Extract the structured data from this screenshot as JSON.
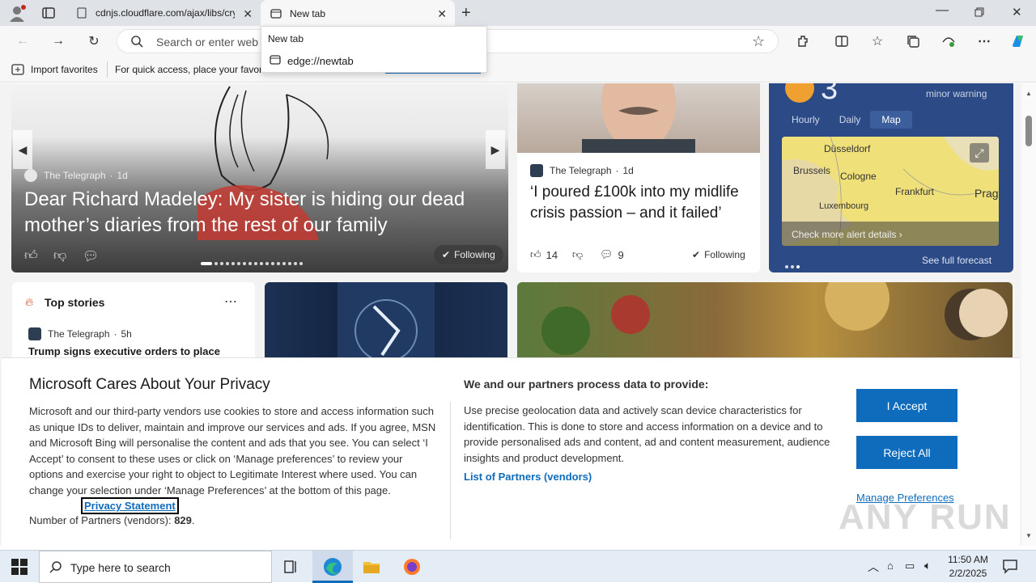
{
  "browser": {
    "tabs": [
      {
        "label": "cdnjs.cloudflare.com/ajax/libs/crypt",
        "active": false
      },
      {
        "label": "New tab",
        "active": true
      }
    ],
    "address_placeholder": "Search or enter web address",
    "dropdown": {
      "title": "New tab",
      "url": "edge://newtab"
    },
    "favorites": {
      "import_label": "Import favorites",
      "hint": "For quick access, place your favorites here on the favorites bar.",
      "manage_link": "Manage favorites now"
    }
  },
  "feed": {
    "hero": {
      "source": "The Telegraph",
      "age": "1d",
      "headline": "Dear Richard Madeley: My sister is hiding our dead mother’s diaries from the rest of our family",
      "following": "Following"
    },
    "story2": {
      "source": "The Telegraph",
      "age": "1d",
      "headline": "‘I poured £100k into my midlife crisis passion – and it failed’",
      "likes": "14",
      "comments": "9",
      "following": "Following"
    },
    "weather": {
      "temp": "3",
      "alert": "minor warning",
      "tabs": [
        "Hourly",
        "Daily",
        "Map"
      ],
      "active_tab": "Map",
      "cities": [
        "Düsseldorf",
        "Brussels",
        "Cologne",
        "Frankfurt",
        "Prag",
        "Luxembourg"
      ],
      "alert_link": "Check more alert details",
      "forecast_link": "See full forecast"
    },
    "top_stories": {
      "title": "Top stories",
      "source": "The Telegraph",
      "age": "5h",
      "headline": "Trump signs executive orders to place"
    }
  },
  "privacy": {
    "title": "Microsoft Cares About Your Privacy",
    "body": "Microsoft and our third-party vendors use cookies to store and access information such as unique IDs to deliver, maintain and improve our services and ads. If you agree, MSN and Microsoft Bing will personalise the content and ads that you see. You can select ‘I Accept’ to consent to these uses or click on ‘Manage preferences’ to review your options and exercise your right to object to Legitimate Interest where used.  You can change your selection under ‘Manage Preferences’ at the bottom of this page.",
    "privacy_link": "Privacy Statement",
    "partners_prefix": "Number of Partners (vendors):",
    "partners_count": "829",
    "right_title": "We and our partners process data to provide:",
    "right_body": "Use precise geolocation data and actively scan device characteristics for identification. This is done to store and access information on a device and to provide personalised ads and content, ad and content measurement, audience insights and product development.",
    "partners_link": "List of Partners (vendors)",
    "accept": "I Accept",
    "reject": "Reject All",
    "manage": "Manage Preferences"
  },
  "taskbar": {
    "search_placeholder": "Type here to search",
    "time": "11:50 AM",
    "date": "2/2/2025"
  },
  "watermark": "ANY RUN",
  "colors": {
    "accent": "#0f6cbd",
    "weather_bg": "#2c4a86"
  }
}
